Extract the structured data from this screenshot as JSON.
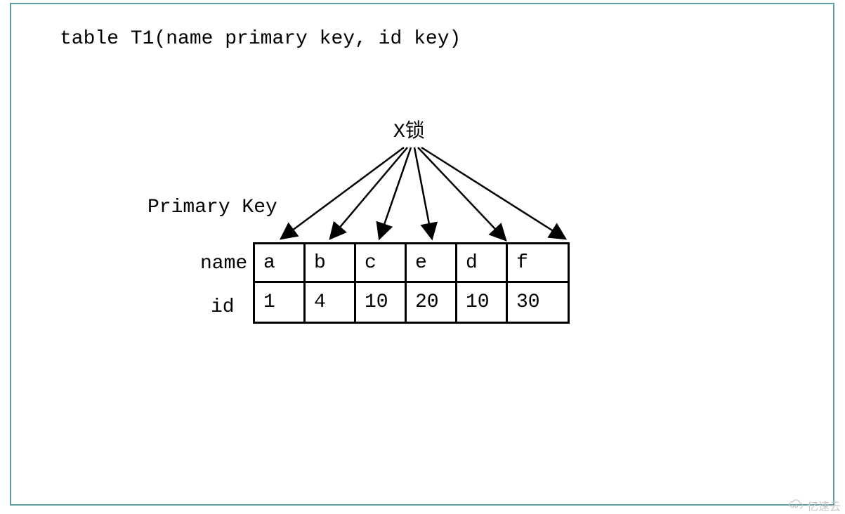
{
  "title": "table T1(name primary key, id key)",
  "xlock_label": "X锁",
  "pk_label": "Primary Key",
  "row_labels": {
    "name": "name",
    "id": "id"
  },
  "table": {
    "name_row": [
      "a",
      "b",
      "c",
      "e",
      "d",
      "f"
    ],
    "id_row": [
      "1",
      "4",
      "10",
      "20",
      "10",
      "30"
    ]
  },
  "watermark": "亿速云",
  "chart_data": {
    "type": "table",
    "title": "table T1(name primary key, id key)",
    "annotations": [
      "X锁",
      "Primary Key"
    ],
    "columns": [
      "name",
      "id"
    ],
    "records": [
      {
        "name": "a",
        "id": 1
      },
      {
        "name": "b",
        "id": 4
      },
      {
        "name": "c",
        "id": 10
      },
      {
        "name": "e",
        "id": 20
      },
      {
        "name": "d",
        "id": 10
      },
      {
        "name": "f",
        "id": 30
      }
    ],
    "arrows": {
      "from": "X锁",
      "to_each_column_of": "name_row",
      "meaning": "X-lock applied to every primary-key record"
    }
  }
}
